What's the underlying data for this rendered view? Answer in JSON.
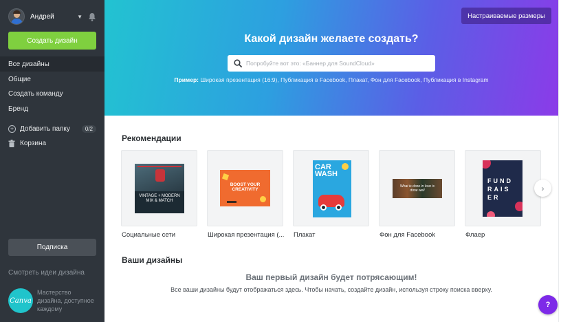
{
  "user": {
    "name": "Андрей"
  },
  "sidebar": {
    "create_label": "Создать дизайн",
    "nav": [
      {
        "label": "Все дизайны",
        "active": true
      },
      {
        "label": "Общие",
        "active": false
      },
      {
        "label": "Создать команду",
        "active": false
      },
      {
        "label": "Бренд",
        "active": false
      }
    ],
    "add_folder_label": "Добавить папку",
    "folder_count": "0/2",
    "trash_label": "Корзина",
    "subscribe_label": "Подписка",
    "ideas_link": "Смотреть идеи дизайна",
    "logo_text": "Canva",
    "promo_text": "Мастерство дизайна, доступное каждому"
  },
  "hero": {
    "custom_size_label": "Настраиваемые размеры",
    "title": "Какой дизайн желаете создать?",
    "search_placeholder": "Попробуйте вот это: «Баннер для SoundCloud»",
    "examples_label": "Пример:",
    "examples": [
      "Широкая презентация (16:9)",
      "Публикация в Facebook",
      "Плакат",
      "Фон для Facebook",
      "Публикация в Instagram"
    ]
  },
  "recommendations": {
    "title": "Рекомендации",
    "items": [
      {
        "label": "Социальные сети",
        "thumb_text": "VINTAGE + MODERN MIX & MATCH"
      },
      {
        "label": "Широкая презентация (...",
        "thumb_text": "BOOST YOUR CREATIVITY"
      },
      {
        "label": "Плакат",
        "thumb_text": "CAR WASH"
      },
      {
        "label": "Фон для Facebook",
        "thumb_text": "What is done in love is done well"
      },
      {
        "label": "Флаер",
        "thumb_text": "FUND RAIS ER"
      }
    ]
  },
  "your_designs": {
    "title": "Ваши дизайны",
    "empty_title": "Ваш первый дизайн будет потрясающим!",
    "empty_subtitle": "Все ваши дизайны будут отображаться здесь. Чтобы начать, создайте дизайн, используя строку поиска вверху."
  },
  "help_label": "?",
  "next_arrow": "›",
  "colors": {
    "sidebar_bg": "#2f353c",
    "create_btn": "#7fd03f",
    "hero_gradient_start": "#22c3d1",
    "hero_gradient_end": "#8b3be8",
    "help_btn": "#7d2ae8"
  }
}
